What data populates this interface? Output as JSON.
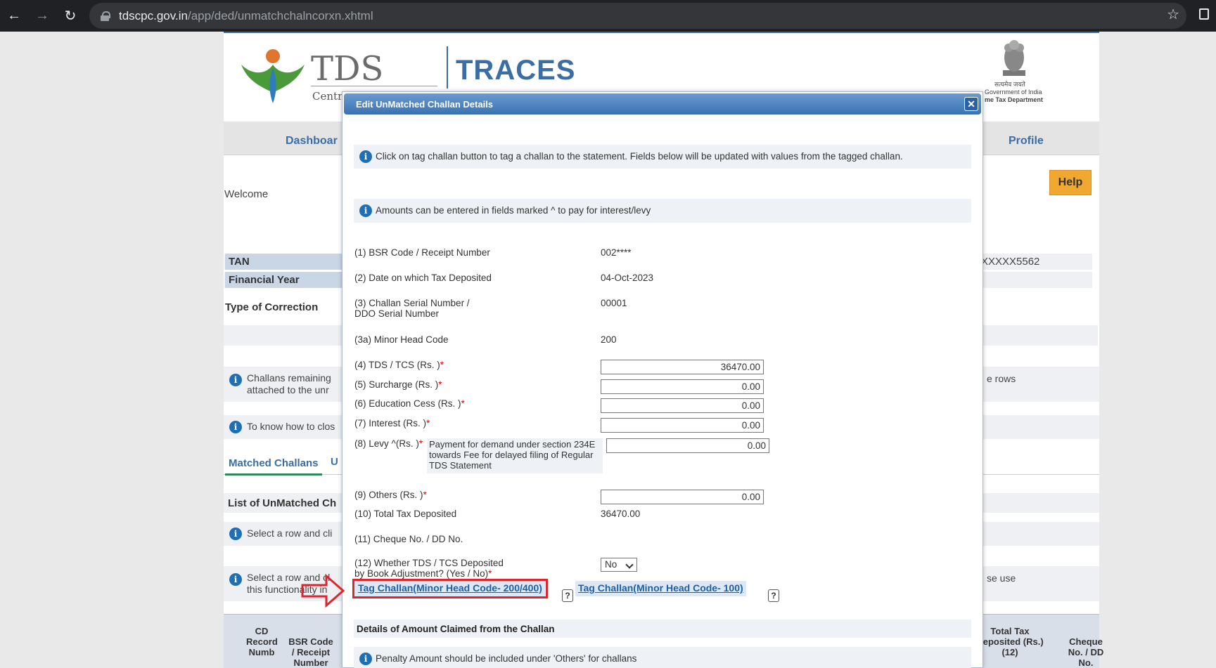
{
  "browser": {
    "url_host": "tdscpc.gov.in",
    "url_path": "/app/ded/unmatchchalncorxn.xhtml"
  },
  "header": {
    "tds_logo_text": "TDS",
    "centra_text": "Centra",
    "traces_text": "TRACES",
    "goi_line1": "सत्यमेव जयते",
    "goi_line2": "Government of India",
    "goi_line3": "me Tax Department"
  },
  "nav": {
    "dashboard": "Dashboar",
    "profile": "Profile"
  },
  "page": {
    "help": "Help",
    "welcome": "Welcome",
    "tan_label": "TAN",
    "fy_label": "Financial Year",
    "tan_value": "XXXXX5562",
    "type_of_correction": "Type of Correction",
    "info_challans_1": "Challans remaining",
    "info_challans_2": "attached to the unr",
    "info_challans_right": "e rows",
    "info_know": "To know how to clos",
    "tab_matched": "Matched Challans",
    "tab_u": "U",
    "list_header": "List of UnMatched Ch",
    "info_select": "Select a row and cli",
    "info_select2_1": "Select a row and cl",
    "info_select2_2": "this functionality in",
    "info_select2_right": "se use",
    "table_headers": {
      "cd": "CD Record Numb",
      "bsr": "BSR Code / Receipt Number",
      "total": "Total Tax Deposited (Rs.) (12)",
      "cheque": "Cheque No. / DD No."
    }
  },
  "modal": {
    "title": "Edit UnMatched Challan Details",
    "info1": "Click on tag challan button to tag a challan to the statement. Fields below will be updated with values from the tagged challan.",
    "info2": "Amounts can be entered in fields marked ^ to pay for interest/levy",
    "fields": {
      "bsr_label": "(1) BSR Code / Receipt Number",
      "bsr_value": "002****",
      "date_label": "(2) Date on which Tax Deposited",
      "date_value": "04-Oct-2023",
      "serial_label_1": "(3) Challan Serial Number /",
      "serial_label_2": "DDO Serial Number",
      "serial_value": "00001",
      "minor_label": "(3a) Minor Head Code",
      "minor_value": "200",
      "tds_label": "(4) TDS / TCS (Rs. )",
      "tds_value": "36470.00",
      "surcharge_label": "(5) Surcharge (Rs. )",
      "surcharge_value": "0.00",
      "cess_label": "(6) Education Cess (Rs. )",
      "cess_value": "0.00",
      "interest_label": "(7) Interest (Rs. )",
      "interest_value": "0.00",
      "levy_label": "(8) Levy ^(Rs. )",
      "levy_note": "Payment for demand under section 234E towards Fee for delayed filing of Regular TDS Statement",
      "levy_value": "0.00",
      "others_label": "(9) Others (Rs. )",
      "others_value": "0.00",
      "total_label": "(10) Total Tax Deposited",
      "total_value": "36470.00",
      "cheque_label": "(11) Cheque No. / DD No.",
      "book_label_1": "(12) Whether TDS / TCS Deposited",
      "book_label_2": "by Book Adjustment? (Yes / No)",
      "book_value": "No"
    },
    "tag_btn_1": "Tag Challan(Minor Head Code- 200/400)",
    "tag_btn_2": "Tag Challan(Minor Head Code- 100)",
    "qmark": "?",
    "details_header": "Details of Amount Claimed from the Challan",
    "penalty_info": "Penalty Amount should be included under 'Others' for challans"
  },
  "colors": {
    "accent": "#3a6ea5",
    "highlight_box": "#e0242d",
    "help": "#f0a830"
  }
}
